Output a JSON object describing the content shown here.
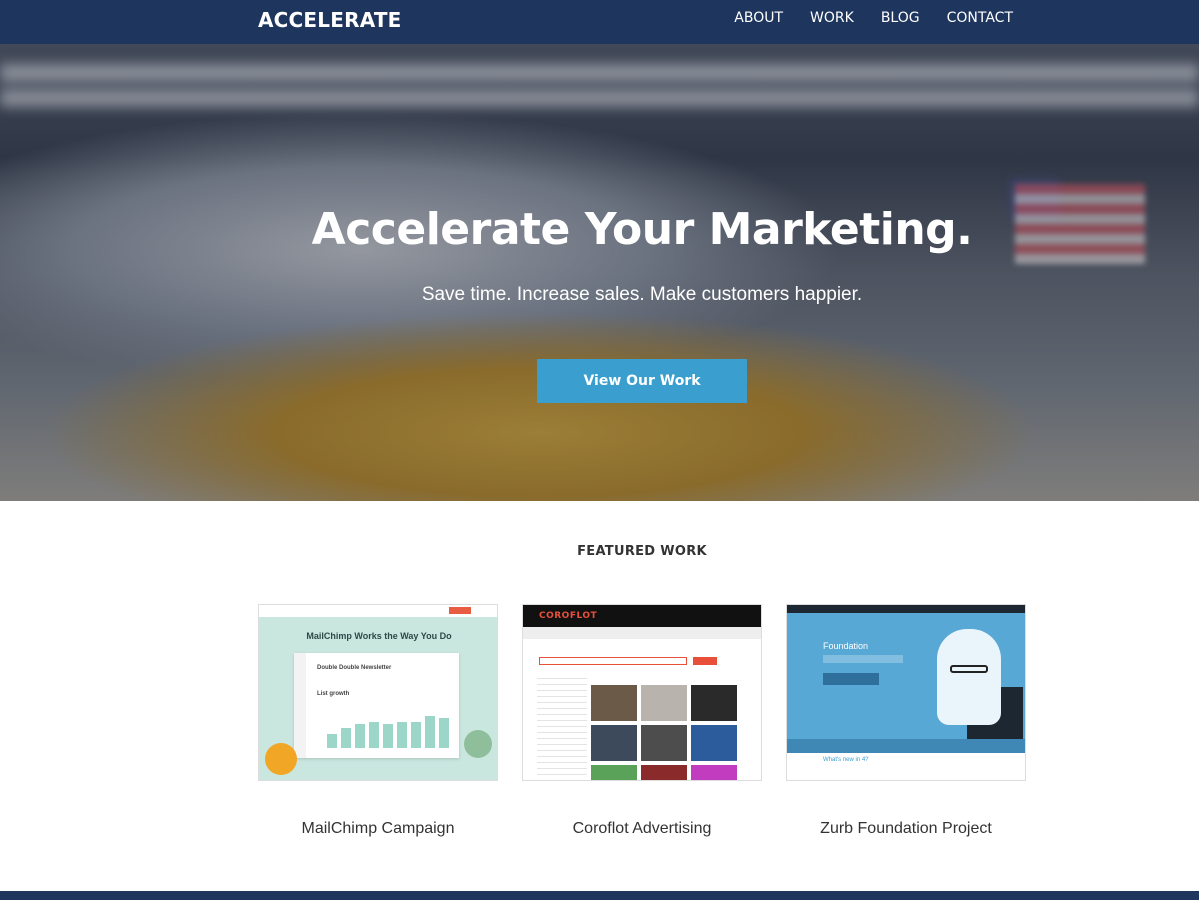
{
  "header": {
    "logo": "ACCELERATE",
    "nav": [
      "ABOUT",
      "WORK",
      "BLOG",
      "CONTACT"
    ]
  },
  "hero": {
    "title": "Accelerate Your Marketing.",
    "subtitle": "Save time. Increase sales. Make customers happier.",
    "cta": "View Our Work"
  },
  "featured": {
    "title": "FEATURED WORK",
    "items": [
      {
        "label": "MailChimp Campaign",
        "thumb_heading": "MailChimp Works the Way You Do",
        "thumb_subheading": "Double Double Newsletter",
        "thumb_section": "List growth"
      },
      {
        "label": "Coroflot Advertising",
        "thumb_brand": "COROFLOT"
      },
      {
        "label": "Zurb Foundation Project",
        "thumb_brand": "Foundation",
        "thumb_footer": "What's new in 4?"
      }
    ]
  },
  "colors": {
    "navy": "#1e355e",
    "button_blue": "#3a9ecf",
    "text_dark": "#333333"
  }
}
